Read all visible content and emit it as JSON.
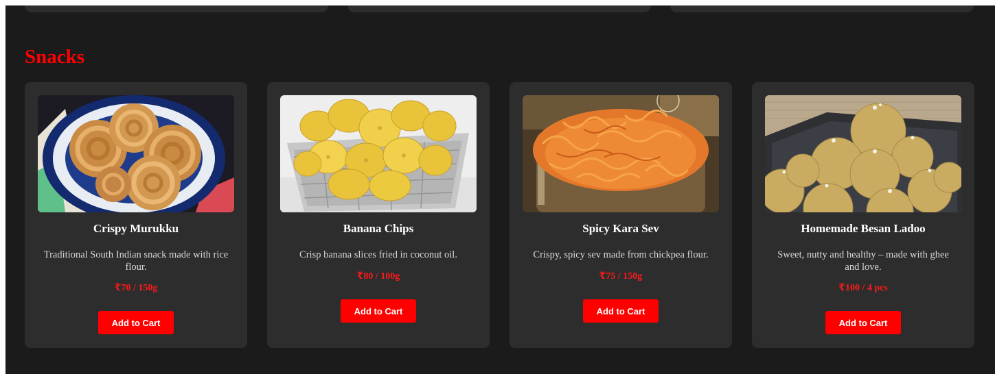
{
  "section": {
    "title": "Snacks"
  },
  "theme": {
    "background": "#1b1b1b",
    "card_background": "#2d2d2d",
    "accent": "#ff0000",
    "title_text": "#ffffff",
    "body_text": "#d7d7d7"
  },
  "products": [
    {
      "name": "Crispy Murukku",
      "description": "Traditional South Indian snack made with rice flour.",
      "price": "₹70 / 150g",
      "button_label": "Add to Cart",
      "image": "murukku-photo"
    },
    {
      "name": "Banana Chips",
      "description": "Crisp banana slices fried in coconut oil.",
      "price": "₹80 / 100g",
      "button_label": "Add to Cart",
      "image": "banana-chips-photo"
    },
    {
      "name": "Spicy Kara Sev",
      "description": "Crispy, spicy sev made from chickpea flour.",
      "price": "₹75 / 150g",
      "button_label": "Add to Cart",
      "image": "kara-sev-photo"
    },
    {
      "name": "Homemade Besan Ladoo",
      "description": "Sweet, nutty and healthy – made with ghee and love.",
      "price": "₹100 / 4 pcs",
      "button_label": "Add to Cart",
      "image": "besan-ladoo-photo"
    }
  ]
}
